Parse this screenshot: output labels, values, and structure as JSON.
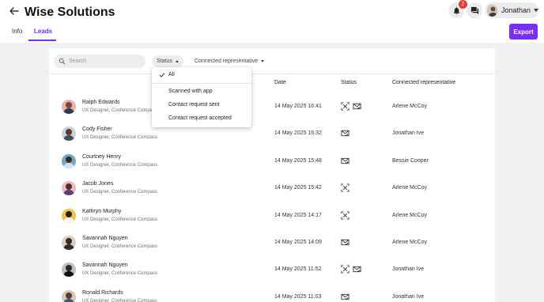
{
  "app": {
    "title": "Wise Solutions",
    "notification_count": "2",
    "user_name": "Jonathan"
  },
  "tabs": [
    {
      "label": "Info",
      "active": false
    },
    {
      "label": "Leads",
      "active": true
    }
  ],
  "export_label": "Export",
  "search": {
    "placeholder": "Search"
  },
  "filters": {
    "status_label": "Status",
    "rep_label": "Connected representative"
  },
  "status_menu": {
    "options": [
      {
        "label": "All",
        "selected": true
      },
      {
        "label": "Scanned with app",
        "selected": false
      },
      {
        "label": "Contact request sent",
        "selected": false
      },
      {
        "label": "Contact request accepted",
        "selected": false
      }
    ]
  },
  "table": {
    "columns": {
      "date": "Date",
      "status": "Status",
      "rep": "Connected representative"
    },
    "rows": [
      {
        "name": "Ralph Edwards",
        "subtitle": "UX Designer, Conference Compass",
        "date": "14 May 2025 16:41",
        "status_icons": [
          "scan-icon",
          "mail-check-icon"
        ],
        "rep": "Arlene McCoy"
      },
      {
        "name": "Cody Fisher",
        "subtitle": "UX Designer, Conference Compass",
        "date": "14 May 2025 16:32",
        "status_icons": [
          "mail-check-icon"
        ],
        "rep": "Jonathan Ive"
      },
      {
        "name": "Courtney Henry",
        "subtitle": "UX Designer, Conference Compass",
        "date": "14 May 2025 15:48",
        "status_icons": [
          "mail-check-icon"
        ],
        "rep": "Bessie Cooper"
      },
      {
        "name": "Jacob Jones",
        "subtitle": "UX Designer, Conference Compass",
        "date": "14 May 2025 15:42",
        "status_icons": [
          "scan-icon"
        ],
        "rep": "Arlene McCoy"
      },
      {
        "name": "Kathryn Murphy",
        "subtitle": "UX Designer, Conference Compass",
        "date": "14 May 2025 14:17",
        "status_icons": [
          "scan-icon"
        ],
        "rep": "Arlene McCoy"
      },
      {
        "name": "Savannah Nguyen",
        "subtitle": "UX Designer, Conference Compass",
        "date": "14 May 2025 14:09",
        "status_icons": [
          "mail-check-icon"
        ],
        "rep": "Arlene McCoy"
      },
      {
        "name": "Savannah Nguyen",
        "subtitle": "UX Designer, Conference Compass",
        "date": "14 May 2025 11:52",
        "status_icons": [
          "scan-icon",
          "mail-check-icon"
        ],
        "rep": "Jonathan Ive"
      },
      {
        "name": "Ronald Richards",
        "subtitle": "UX Designer, Conference Compass",
        "date": "14 May 2025 11:03",
        "status_icons": [
          "mail-check-icon"
        ],
        "rep": "Jonathan Ive"
      }
    ]
  },
  "colors": {
    "accent": "#7b2cf5",
    "badge": "#e53935",
    "avatar_bg": [
      "#e8b4a6",
      "#c9d3da",
      "#6fa7c8",
      "#f2b9b9",
      "#f4c542",
      "#d9d1c7",
      "#bfbfbf",
      "#d6c7b8"
    ],
    "avatar_head": [
      "#7a4a36",
      "#5a3b2b",
      "#3b2a20",
      "#4a3326",
      "#2b1d14",
      "#3a2a22",
      "#2a2a2a",
      "#5b3d2d"
    ],
    "avatar_torso": [
      "#2f3b57",
      "#3e4e5e",
      "#d9e3ea",
      "#5a3f7a",
      "#f6f6f6",
      "#2b2b2b",
      "#111111",
      "#3b5b7a"
    ]
  }
}
